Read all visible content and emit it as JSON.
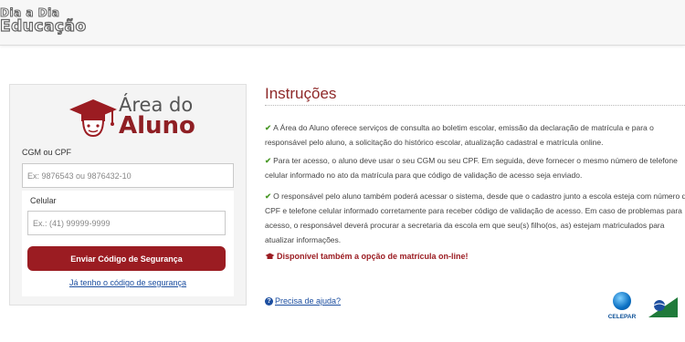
{
  "header": {
    "logo_line1": "Dia a Dia",
    "logo_line2": "Educação"
  },
  "login": {
    "brand_line1": "Área do",
    "brand_line2": "Aluno",
    "cgm_label": "CGM ou CPF",
    "cgm_placeholder": "Ex: 9876543 ou 9876432-10",
    "celular_label": "Celular",
    "celular_placeholder": "Ex.: (41) 99999-9999",
    "send_button": "Enviar Código de Segurança",
    "have_code_link": "Já tenho o código de segurança"
  },
  "instructions": {
    "title": "Instruções",
    "items": [
      {
        "line1": "A Área do Aluno oferece serviços de consulta ao boletim escolar, emissão da declaração de matrícula e para o",
        "line2": "responsável pelo aluno, a solicitação do histórico escolar, atualização cadastral e matrícula online."
      },
      {
        "line1": "Para ter acesso, o aluno deve usar o seu CGM ou seu CPF. Em seguida, deve fornecer o mesmo número de telefone",
        "line2": "celular informado no ato da matrícula para que código de validação de acesso seja enviado."
      },
      {
        "line1": "O responsável pelo aluno também poderá acessar o sistema, desde que o cadastro junto a escola esteja com número de",
        "line2": "CPF e telefone celular informado corretamente para receber código de validação de acesso. Em caso de problemas para",
        "line3": "acesso, o responsável deverá procurar a secretaria da escola em que seu(s) filho(os, as) estejam matriculados para",
        "line4": "atualizar informações."
      }
    ],
    "note": "Disponível também a opção de matrícula on-line!",
    "help_link": "Precisa de ajuda?"
  },
  "footer": {
    "celepar_label": "CELEPAR"
  },
  "colors": {
    "brand_red": "#9b1c22",
    "link_blue": "#1d4fa0",
    "check_green": "#4c9a2a"
  },
  "icons": {
    "check": "check-icon",
    "cap": "graduation-cap-icon",
    "help": "question-circle-icon",
    "note": "graduation-cap-icon"
  }
}
